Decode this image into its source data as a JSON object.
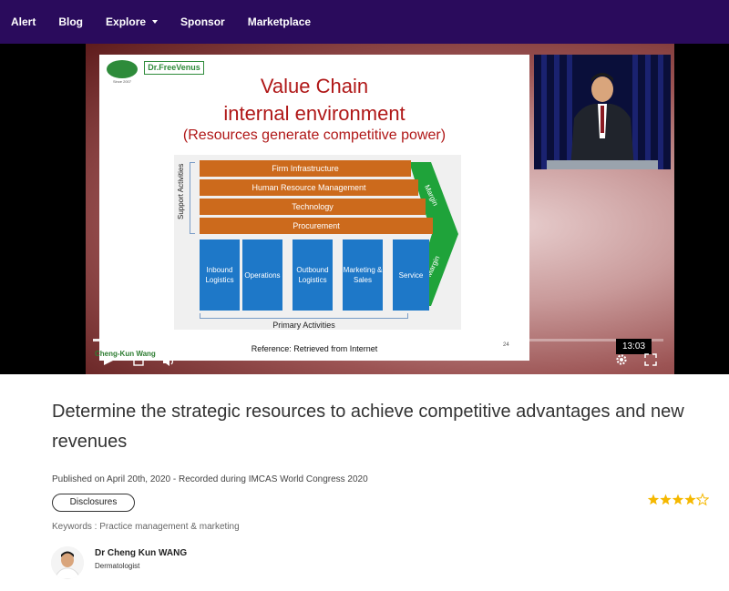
{
  "nav": {
    "items": [
      {
        "label": "Alert"
      },
      {
        "label": "Blog"
      },
      {
        "label": "Explore"
      },
      {
        "label": "Sponsor"
      },
      {
        "label": "Marketplace"
      }
    ]
  },
  "slide": {
    "logo_left_caption": "Since 2007",
    "logo_right_text": "Dr.FreeVenus",
    "title_line1": "Value Chain",
    "title_line2": "internal environment",
    "subtitle": "(Resources generate competitive power)",
    "support_label": "Support Activities",
    "support_activities": [
      "Firm Infrastructure",
      "Human Resource Management",
      "Technology",
      "Procurement"
    ],
    "primary_activities": [
      "Inbound Logistics",
      "Operations",
      "Outbound Logistics",
      "Marketing & Sales",
      "Service"
    ],
    "primary_label": "Primary Activities",
    "margin_label": "Margin",
    "reference": "Reference: Retrieved from Internet",
    "slide_number": "24"
  },
  "player": {
    "lower_third_name": "Cheng-Kun Wang",
    "time_tooltip": "13:03",
    "progress": 0.27
  },
  "video": {
    "title": "Determine the strategic resources to achieve competitive advantages and new revenues",
    "published": "Published on April 20th, 2020 - Recorded during IMCAS World Congress 2020",
    "disclosures_label": "Disclosures",
    "rating": 4,
    "rating_max": 5,
    "star_color": "#f5b800",
    "keywords": "Keywords : Practice management & marketing"
  },
  "author": {
    "name": "Dr Cheng Kun WANG",
    "role": "Dermatologist"
  },
  "colors": {
    "nav_bg": "#2a0b5c",
    "support_bar": "#cc6a1c",
    "primary_block": "#1e78c8",
    "margin_arrow": "#1fa33a",
    "slide_title": "#b01818"
  }
}
